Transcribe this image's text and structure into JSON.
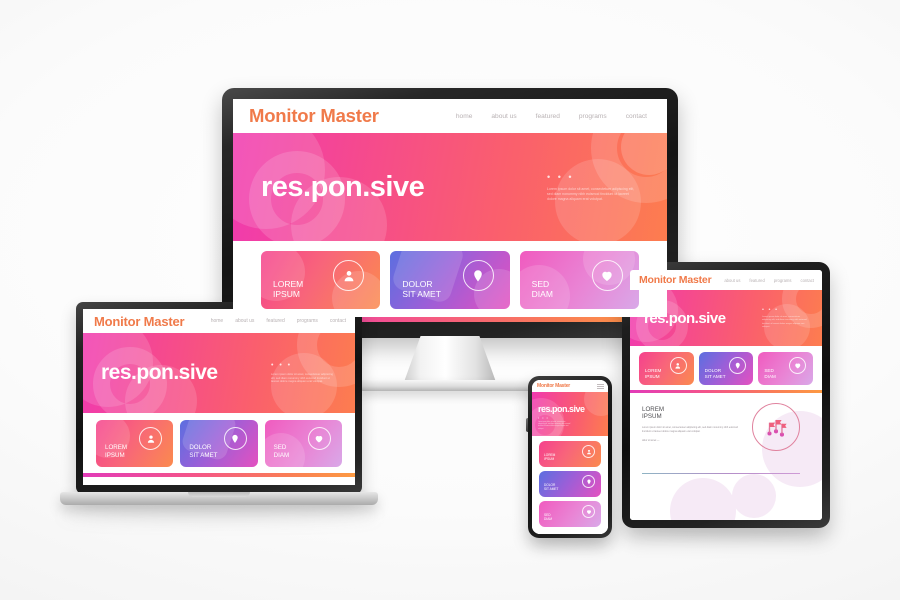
{
  "site": {
    "brand": "Monitor Master",
    "nav": [
      "home",
      "about us",
      "featured",
      "programs",
      "contact"
    ],
    "hero": {
      "title": "res.pon.sive",
      "dots": "• • •",
      "paragraph": "Lorem ipsum dolor sit amet, consectetuer adipiscing elit, sed diam nonummy nibh euismod tincidunt ut laoreet dolore magna aliquam erat volutpat."
    },
    "cards": [
      {
        "label": "LOREM\nIPSUM",
        "line1": "LOREM",
        "line2": "IPSUM",
        "icon": "person-icon",
        "accent": "#f8657a"
      },
      {
        "label": "DOLOR\nSIT AMET",
        "line1": "DOLOR",
        "line2": "SIT AMET",
        "icon": "location-pin-icon",
        "accent": "#9a5fd8"
      },
      {
        "label": "SED\nDIAM",
        "line1": "SED",
        "line2": "DIAM",
        "icon": "heart-icon",
        "accent": "#e985d5"
      }
    ],
    "feature": {
      "title_line1": "LOREM",
      "title_line2": "IPSUM",
      "paragraph": "Lorem ipsum dolor sit amet, consectetuer adipiscing elit, sed diam nonummy nibh euismod tincidunt ut laoreet dolore magna aliquam erat volutpat.",
      "link": "dolor sit amet —",
      "icon": "flags-milestone-icon"
    },
    "menu_icon": "hamburger-menu-icon"
  },
  "devices": {
    "monitor": {
      "name": "desktop-monitor"
    },
    "laptop": {
      "name": "laptop"
    },
    "tablet": {
      "name": "tablet"
    },
    "phone": {
      "name": "smartphone"
    }
  },
  "colors": {
    "brand": "#f07a4a",
    "hero_from": "#f03ab0",
    "hero_to": "#fd7d4f",
    "nav_text": "#b9b2b4",
    "background": "#f2f2f2"
  }
}
